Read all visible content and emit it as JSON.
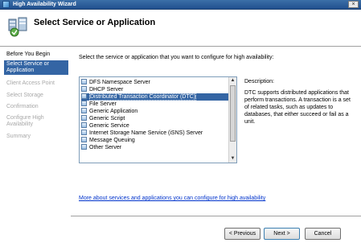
{
  "window": {
    "title": "High Availability Wizard",
    "close_glyph": "×"
  },
  "header": {
    "title": "Select Service or Application",
    "icon": "cluster-wizard-icon"
  },
  "sidebar": {
    "items": [
      {
        "label": "Before You Begin",
        "state": "done"
      },
      {
        "label": "Select Service or Application",
        "state": "active"
      },
      {
        "label": "Client Access Point",
        "state": "pending"
      },
      {
        "label": "Select Storage",
        "state": "pending"
      },
      {
        "label": "Confirmation",
        "state": "pending"
      },
      {
        "label": "Configure High Availability",
        "state": "pending"
      },
      {
        "label": "Summary",
        "state": "pending"
      }
    ]
  },
  "main": {
    "instruction": "Select the service or application that you want to configure for high availability:",
    "list": [
      {
        "label": "DFS Namespace Server"
      },
      {
        "label": "DHCP Server"
      },
      {
        "label": "Distributed Transaction Coordinator (DTC)",
        "selected": true
      },
      {
        "label": "File Server"
      },
      {
        "label": "Generic Application"
      },
      {
        "label": "Generic Script"
      },
      {
        "label": "Generic Service"
      },
      {
        "label": "Internet Storage Name Service (iSNS) Server"
      },
      {
        "label": "Message Queuing"
      },
      {
        "label": "Other Server"
      }
    ],
    "description_label": "Description:",
    "description_text": "DTC supports distributed applications that perform transactions. A transaction is a set of related tasks, such as updates to databases, that either succeed or fail as a unit.",
    "link": "More about services and applications you can configure for high availability"
  },
  "buttons": {
    "previous": "< Previous",
    "next": "Next >",
    "cancel": "Cancel"
  },
  "colors": {
    "selection": "#3465a4",
    "titlebar": "#2c5d9a",
    "link": "#0033cc",
    "disabled_text": "#a8a8a8"
  }
}
